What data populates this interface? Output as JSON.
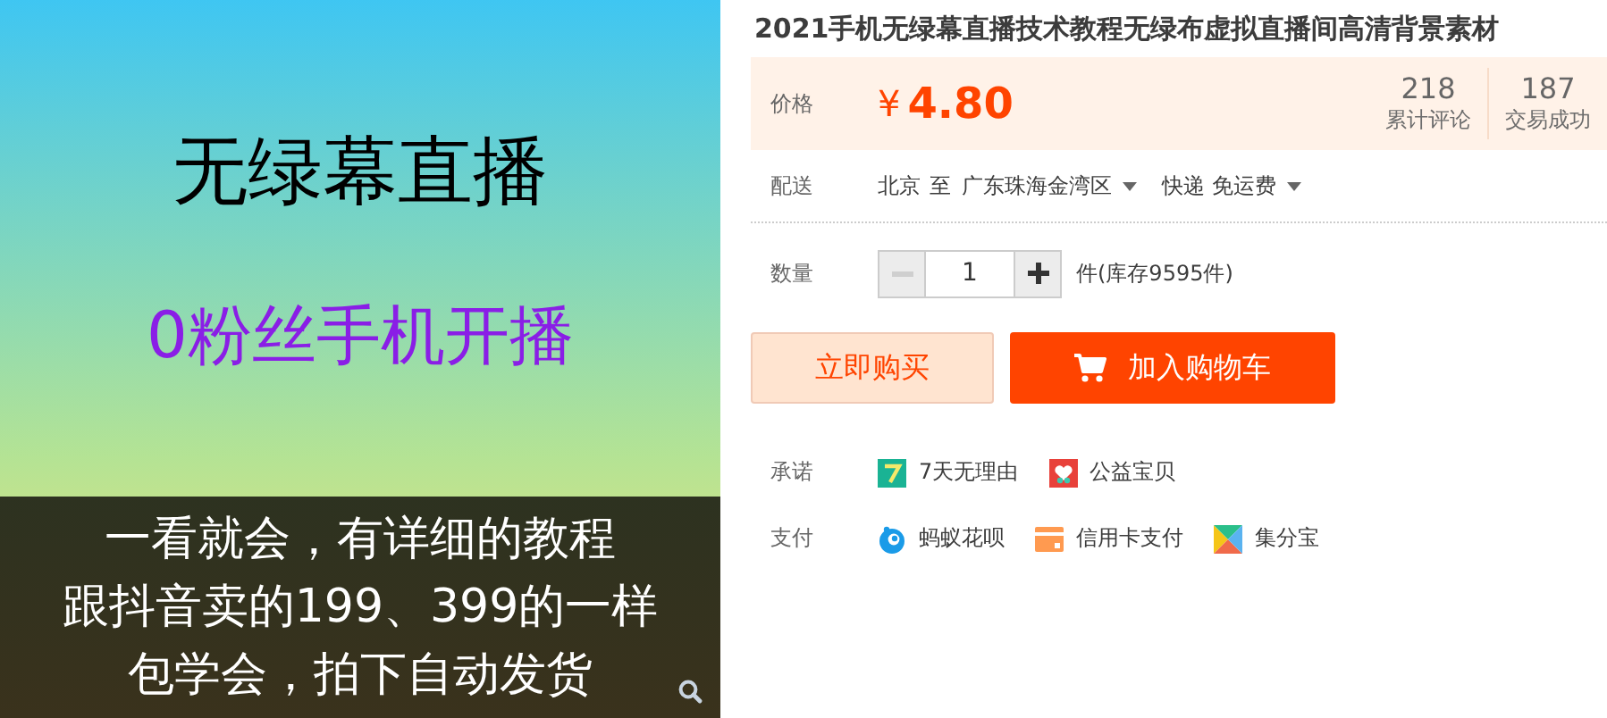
{
  "image": {
    "headline": "无绿幕直播",
    "subline": "0粉丝手机开播",
    "caption_lines": [
      "一看就会，有详细的教程",
      "跟抖音卖的199、399的一样",
      "包学会，拍下自动发货"
    ]
  },
  "title": "2021手机无绿幕直播技术教程无绿布虚拟直播间高清背景素材",
  "price": {
    "label": "价格",
    "currency": "¥",
    "amount": "4.80"
  },
  "stats": [
    {
      "value": "218",
      "label": "累计评论"
    },
    {
      "value": "187",
      "label": "交易成功"
    }
  ],
  "delivery": {
    "label": "配送",
    "from": "北京",
    "to_word": "至",
    "destination": "广东珠海金湾区",
    "shipping": "快递 免运费"
  },
  "quantity": {
    "label": "数量",
    "value": "1",
    "decrease_disabled": true,
    "stock": "件(库存9595件)"
  },
  "buttons": {
    "buy_now": "立即购买",
    "add_to_cart": "加入购物车"
  },
  "promises": {
    "label": "承诺",
    "items": [
      {
        "kind": "seven-day",
        "text": "7天无理由"
      },
      {
        "kind": "charity",
        "text": "公益宝贝"
      }
    ]
  },
  "payment": {
    "label": "支付",
    "items": [
      {
        "kind": "huabei",
        "text": "蚂蚁花呗"
      },
      {
        "kind": "credit-card",
        "text": "信用卡支付"
      },
      {
        "kind": "jifenbao",
        "text": "集分宝"
      }
    ]
  }
}
